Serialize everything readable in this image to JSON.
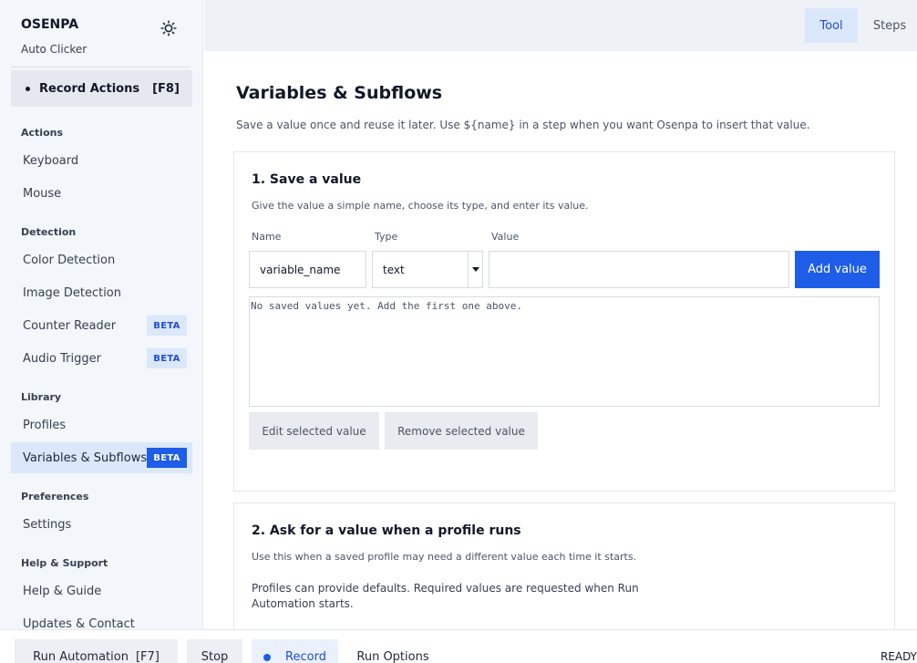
{
  "brand": {
    "title": "OSENPA",
    "subtitle": "Auto Clicker"
  },
  "record": {
    "label": "Record Actions",
    "shortcut": "[F8]"
  },
  "sidebar": {
    "sections": [
      {
        "label": "Actions",
        "items": [
          {
            "label": "Keyboard"
          },
          {
            "label": "Mouse"
          }
        ]
      },
      {
        "label": "Detection",
        "items": [
          {
            "label": "Color Detection"
          },
          {
            "label": "Image Detection"
          },
          {
            "label": "Counter Reader",
            "badge": "BETA"
          },
          {
            "label": "Audio Trigger",
            "badge": "BETA"
          }
        ]
      },
      {
        "label": "Library",
        "items": [
          {
            "label": "Profiles"
          },
          {
            "label": "Variables & Subflows",
            "badge": "BETA",
            "active": true
          }
        ]
      },
      {
        "label": "Preferences",
        "items": [
          {
            "label": "Settings"
          }
        ]
      },
      {
        "label": "Help & Support",
        "items": [
          {
            "label": "Help & Guide"
          },
          {
            "label": "Updates & Contact"
          }
        ]
      }
    ]
  },
  "topbar": {
    "tabs": [
      {
        "label": "Tool",
        "active": true
      },
      {
        "label": "Steps"
      }
    ]
  },
  "page": {
    "title": "Variables & Subflows",
    "description": "Save a value once and reuse it later. Use ${name} in a step when you want Osenpa to insert that value."
  },
  "card1": {
    "title": "1. Save a value",
    "description": "Give the value a simple name, choose its type, and enter its value.",
    "name_label": "Name",
    "type_label": "Type",
    "value_label": "Value",
    "name_value": "variable_name",
    "type_value": "text",
    "value_value": "",
    "add_button": "Add value",
    "list_empty": "No saved values yet. Add the first one above.",
    "edit_button": "Edit selected value",
    "remove_button": "Remove selected value"
  },
  "card2": {
    "title": "2. Ask for a value when a profile runs",
    "description": "Use this when a saved profile may need a different value each time it starts.",
    "note": "Profiles can provide defaults. Required values are requested when Run Automation starts."
  },
  "bottombar": {
    "run": "Run Automation",
    "run_shortcut": "[F7]",
    "stop": "Stop",
    "record": "Record",
    "run_options": "Run Options",
    "status": "READY"
  },
  "colors": {
    "accent": "#1d5de8",
    "sidebar_bg": "#f3f6fa",
    "active_bg": "#dbe7fa"
  }
}
